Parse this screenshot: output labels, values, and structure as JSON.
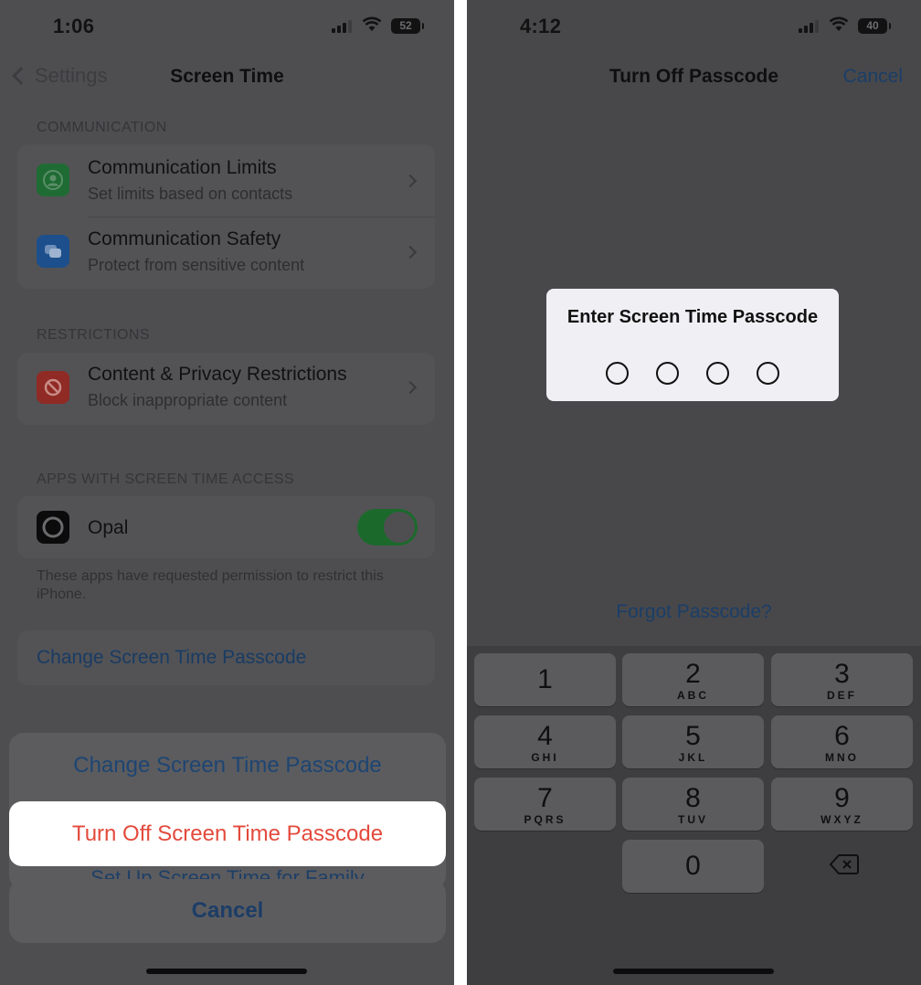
{
  "left_screen": {
    "status": {
      "time": "1:06",
      "battery": "52"
    },
    "nav": {
      "back_label": "Settings",
      "title": "Screen Time"
    },
    "communication": {
      "header": "COMMUNICATION",
      "items": [
        {
          "title": "Communication Limits",
          "subtitle": "Set limits based on contacts"
        },
        {
          "title": "Communication Safety",
          "subtitle": "Protect from sensitive content"
        }
      ]
    },
    "restrictions": {
      "header": "RESTRICTIONS",
      "items": [
        {
          "title": "Content & Privacy Restrictions",
          "subtitle": "Block inappropriate content"
        }
      ]
    },
    "apps": {
      "header": "APPS WITH SCREEN TIME ACCESS",
      "items": [
        {
          "title": "Opal",
          "enabled": true
        }
      ],
      "footnote": "These apps have requested permission to restrict this iPhone."
    },
    "change_passcode_link": "Change Screen Time Passcode",
    "action_sheet": {
      "change": "Change Screen Time Passcode",
      "turn_off": "Turn Off Screen Time Passcode",
      "peek": "Set Up Screen Time for Family",
      "cancel": "Cancel"
    }
  },
  "right_screen": {
    "status": {
      "time": "4:12",
      "battery": "40"
    },
    "nav": {
      "title": "Turn Off Passcode",
      "cancel_label": "Cancel"
    },
    "passcode_prompt": "Enter Screen Time Passcode",
    "forgot_link": "Forgot Passcode?",
    "keypad": [
      {
        "num": "1",
        "letters": ""
      },
      {
        "num": "2",
        "letters": "ABC"
      },
      {
        "num": "3",
        "letters": "DEF"
      },
      {
        "num": "4",
        "letters": "GHI"
      },
      {
        "num": "5",
        "letters": "JKL"
      },
      {
        "num": "6",
        "letters": "MNO"
      },
      {
        "num": "7",
        "letters": "PQRS"
      },
      {
        "num": "8",
        "letters": "TUV"
      },
      {
        "num": "9",
        "letters": "WXYZ"
      },
      {
        "num": "0",
        "letters": ""
      }
    ],
    "icons": {
      "delete": "delete-backspace-icon"
    }
  },
  "colors": {
    "link_blue": "#1b3e67",
    "destructive_red": "#e34a3c",
    "toggle_green": "#1b6a2c",
    "highlight_white": "#ffffff"
  }
}
